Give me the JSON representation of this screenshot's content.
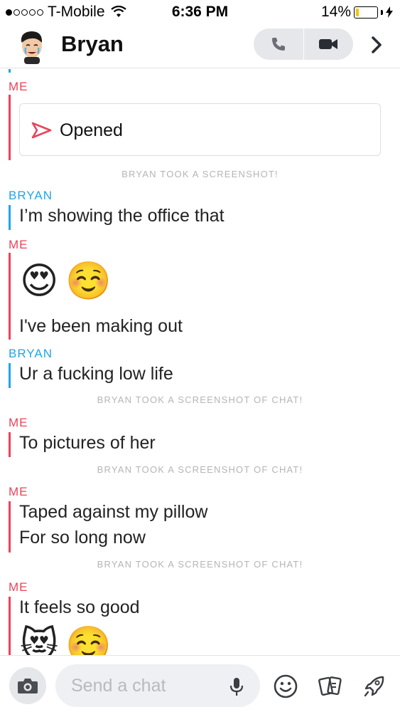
{
  "status_bar": {
    "carrier": "T-Mobile",
    "time": "6:36 PM",
    "battery": "14%",
    "battery_level": 0.14
  },
  "header": {
    "contact_name": "Bryan"
  },
  "chat": {
    "opened_label": "Opened",
    "senders": {
      "me": "ME",
      "bryan": "BRYAN"
    },
    "notices": {
      "screenshot": "BRYAN TOOK A SCREENSHOT!",
      "screenshot_chat": "BRYAN TOOK A SCREENSHOT OF CHAT!"
    },
    "messages": {
      "m1": "I’m showing the office that",
      "m2_emoji_a": "😍",
      "m2_emoji_b": "☺️",
      "m3": "I've been making out",
      "m4": "Ur a fucking low life",
      "m5": "To pictures of her",
      "m6": "Taped against my pillow",
      "m7": "For so long now",
      "m8": "It feels so good",
      "m9_emoji_a": "😻",
      "m9_emoji_b": "☺️"
    }
  },
  "bottom_bar": {
    "chat_placeholder": "Send a chat"
  },
  "colors": {
    "me": "#e9445a",
    "bryan": "#1fa6e6",
    "notice": "#b5b5b5",
    "pill": "#e6e7ea"
  }
}
